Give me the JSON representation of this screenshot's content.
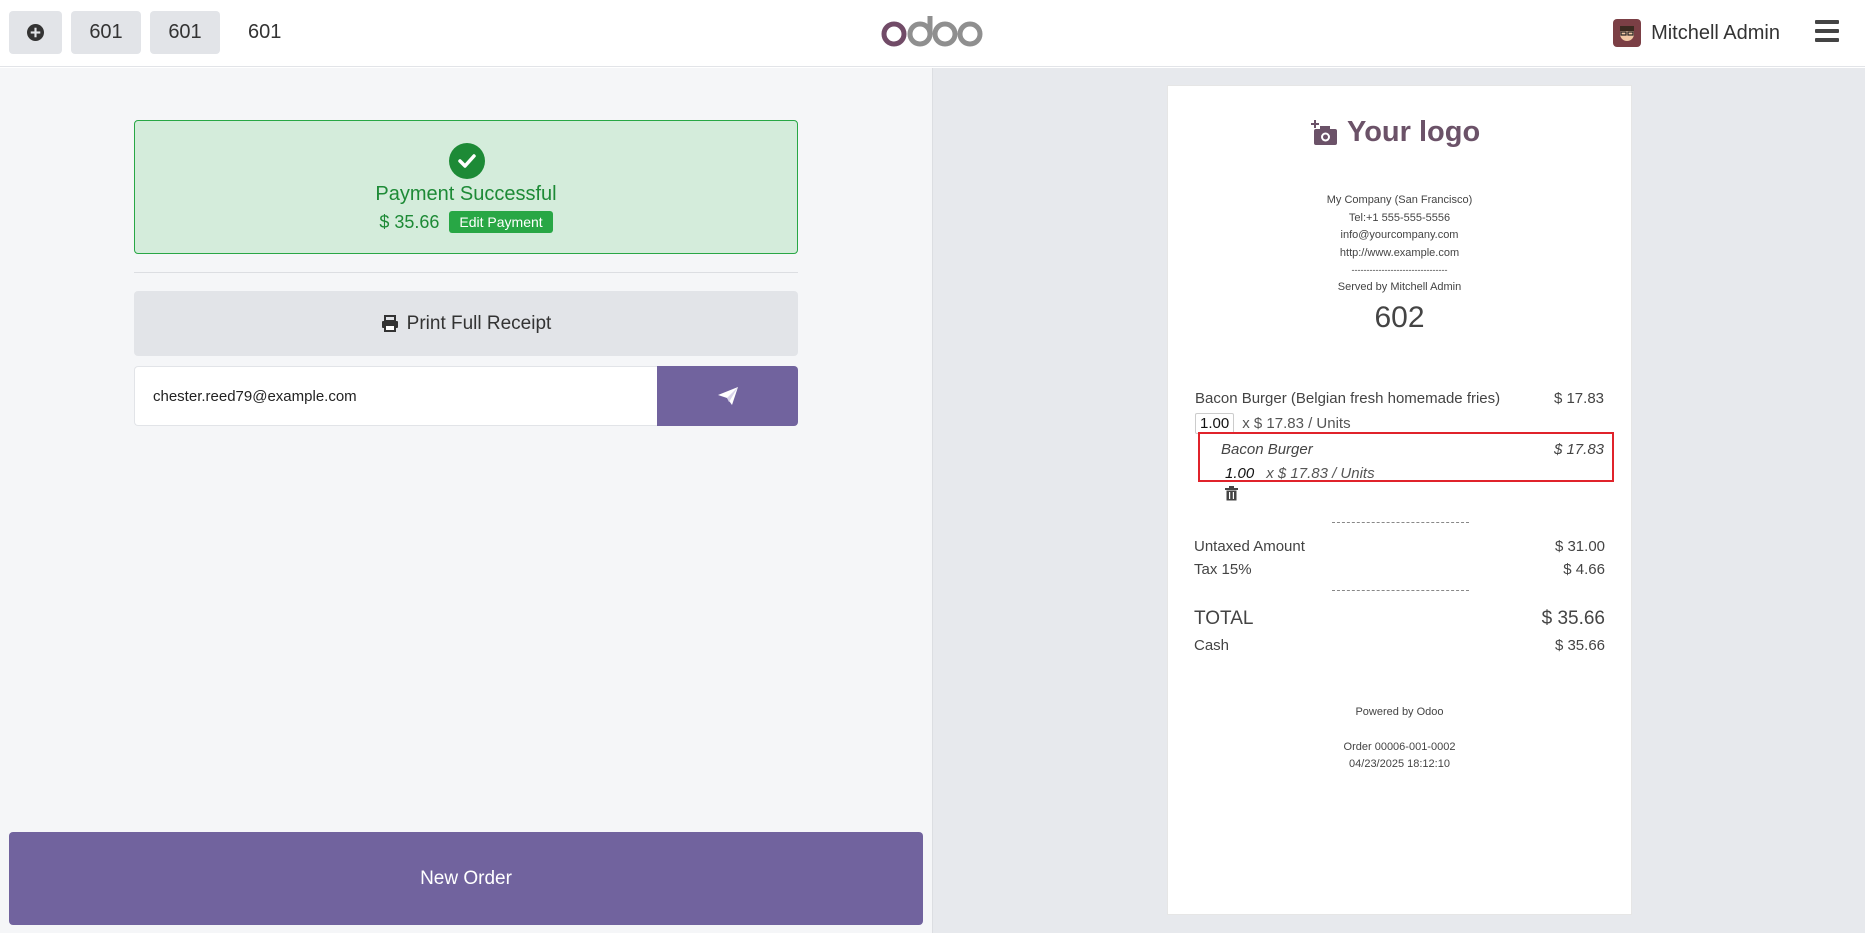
{
  "topbar": {
    "order_tabs": [
      "601",
      "601"
    ],
    "current_order": "601",
    "brand": "odoo",
    "user_name": "Mitchell Admin"
  },
  "payment": {
    "status_title": "Payment Successful",
    "amount": "$ 35.66",
    "edit_label": "Edit Payment",
    "print_label": "Print Full Receipt",
    "email_value": "chester.reed79@example.com",
    "new_order_label": "New Order"
  },
  "receipt": {
    "logo_text": "Your logo",
    "company_lines": [
      "My Company (San Francisco)",
      "Tel:+1 555-555-5556",
      "info@yourcompany.com",
      "http://www.example.com",
      "--------------------------------",
      "Served by Mitchell Admin"
    ],
    "order_number": "602",
    "lines": [
      {
        "name": "Bacon Burger (Belgian fresh homemade fries)",
        "price": "$ 17.83",
        "qty": "1.00",
        "unit_price": "x $ 17.83 / Units"
      }
    ],
    "combo_line": {
      "name": "Bacon Burger",
      "price": "$ 17.83",
      "qty": "1.00",
      "unit_price": "x $ 17.83 / Units"
    },
    "untaxed_label": "Untaxed Amount",
    "untaxed_value": "$ 31.00",
    "tax_label": "Tax 15%",
    "tax_value": "$ 4.66",
    "total_label": "TOTAL",
    "total_value": "$ 35.66",
    "payment_method": "Cash",
    "payment_value": "$ 35.66",
    "powered_by": "Powered by Odoo",
    "order_ref": "Order 00006-001-0002",
    "order_datetime": "04/23/2025 18:12:10"
  },
  "colors": {
    "primary": "#71639e",
    "success": "#28a745",
    "success_bg": "#d4ecdb",
    "highlight": "#e0232b"
  }
}
